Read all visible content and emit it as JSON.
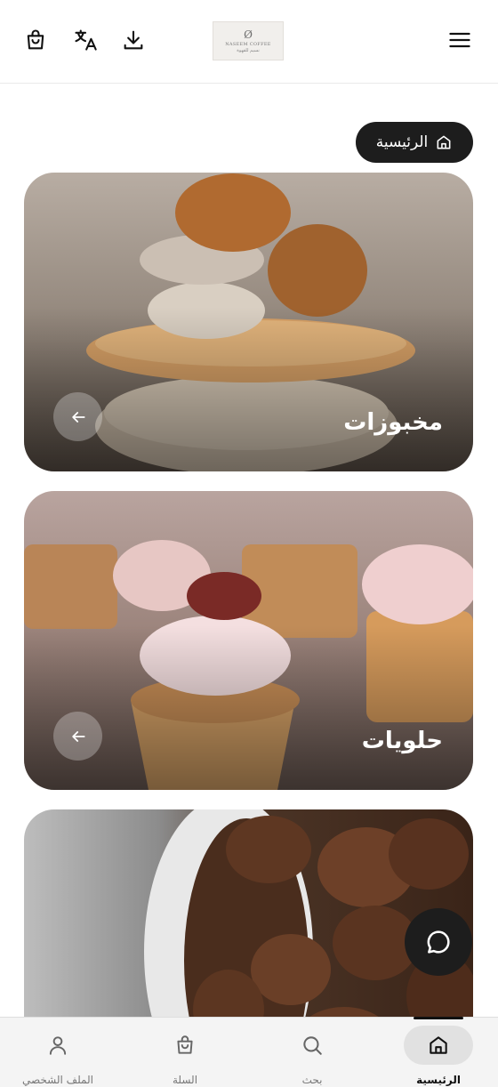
{
  "header": {
    "logo": {
      "mark": "Ø",
      "name": "NASEEM COFFEE",
      "name_ar": "نسيم للقهوة"
    },
    "icons": [
      "bag-icon",
      "translate-icon",
      "download-icon",
      "menu-icon"
    ]
  },
  "breadcrumb": {
    "label": "الرئيسية",
    "icon": "home-icon"
  },
  "categories": [
    {
      "title": "مخبوزات",
      "arrow_icon": "arrow-left-icon"
    },
    {
      "title": "حلويات",
      "arrow_icon": "arrow-left-icon"
    },
    {
      "title": "",
      "arrow_icon": ""
    }
  ],
  "chat": {
    "icon": "chat-bubble-icon"
  },
  "bottom_nav": {
    "items": [
      {
        "label": "الرئيسية",
        "icon": "home-icon",
        "active": true
      },
      {
        "label": "بحث",
        "icon": "search-icon",
        "active": false
      },
      {
        "label": "السلة",
        "icon": "bag-icon",
        "active": false
      },
      {
        "label": "الملف الشخصي",
        "icon": "person-icon",
        "active": false
      }
    ]
  },
  "colors": {
    "dark": "#1d1d1d",
    "nav_bg": "#f4f4f4",
    "active_pill": "#e1e1e1"
  }
}
